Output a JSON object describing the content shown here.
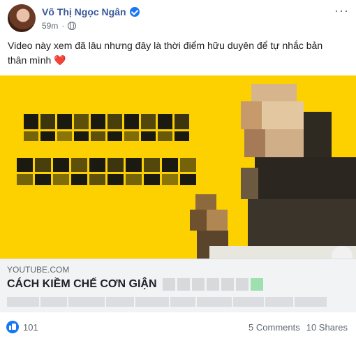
{
  "post": {
    "author": "Võ Thị Ngọc Ngân",
    "time": "59m",
    "separator": "·",
    "more_label": "···",
    "text": "Video này xem đã lâu nhưng đây là thời điểm hữu duyên để tự nhắc bản thân mình",
    "heart": "❤️"
  },
  "link": {
    "domain": "YOUTUBE.COM",
    "title": "CÁCH KIỀM CHẾ CƠN GIẬN"
  },
  "footer": {
    "like_count": "101",
    "comments": "5 Comments",
    "shares": "10 Shares"
  },
  "colors": {
    "brand_blue": "#1877f2",
    "author_blue": "#385898",
    "media_yellow": "#fdd000"
  },
  "icons": [
    "verified-badge-icon",
    "globe-icon",
    "more-options-icon",
    "like-reaction-icon"
  ]
}
